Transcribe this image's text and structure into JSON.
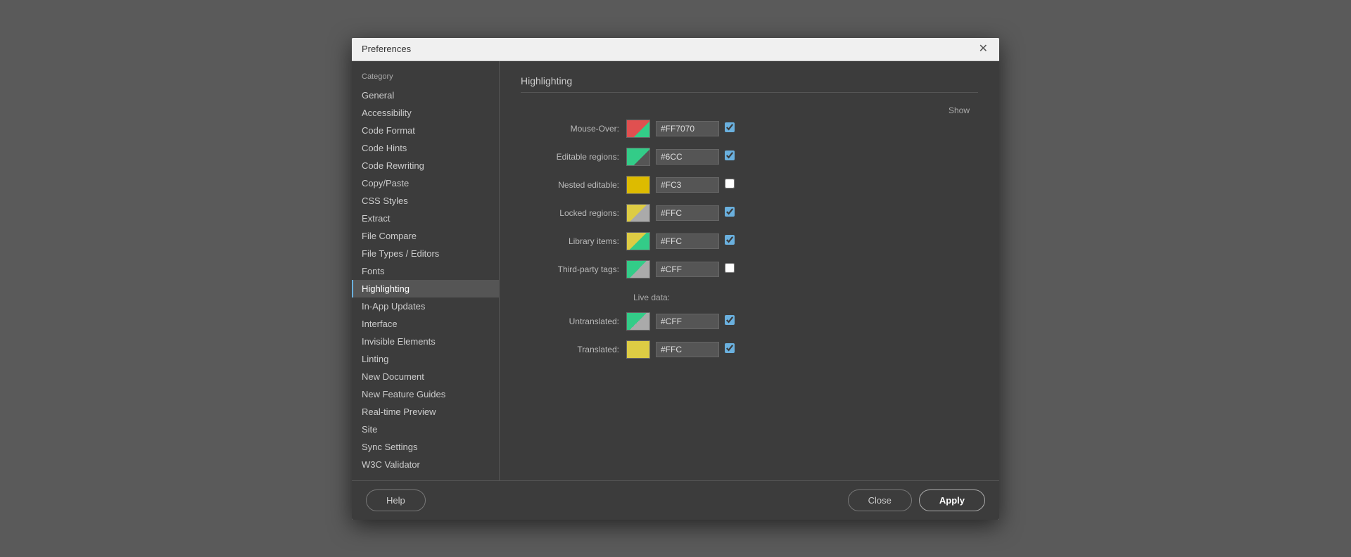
{
  "dialog": {
    "title": "Preferences",
    "close_label": "✕"
  },
  "sidebar": {
    "header": "Category",
    "items": [
      {
        "label": "General",
        "active": false
      },
      {
        "label": "Accessibility",
        "active": false
      },
      {
        "label": "Code Format",
        "active": false
      },
      {
        "label": "Code Hints",
        "active": false
      },
      {
        "label": "Code Rewriting",
        "active": false
      },
      {
        "label": "Copy/Paste",
        "active": false
      },
      {
        "label": "CSS Styles",
        "active": false
      },
      {
        "label": "Extract",
        "active": false
      },
      {
        "label": "File Compare",
        "active": false
      },
      {
        "label": "File Types / Editors",
        "active": false
      },
      {
        "label": "Fonts",
        "active": false
      },
      {
        "label": "Highlighting",
        "active": true
      },
      {
        "label": "In-App Updates",
        "active": false
      },
      {
        "label": "Interface",
        "active": false
      },
      {
        "label": "Invisible Elements",
        "active": false
      },
      {
        "label": "Linting",
        "active": false
      },
      {
        "label": "New Document",
        "active": false
      },
      {
        "label": "New Feature Guides",
        "active": false
      },
      {
        "label": "Real-time Preview",
        "active": false
      },
      {
        "label": "Site",
        "active": false
      },
      {
        "label": "Sync Settings",
        "active": false
      },
      {
        "label": "W3C Validator",
        "active": false
      }
    ]
  },
  "content": {
    "title": "Highlighting",
    "show_label": "Show",
    "rows": [
      {
        "label": "Mouse-Over:",
        "color": "#FF7070",
        "checked": true,
        "swatch_class": "swatch-mouseover"
      },
      {
        "label": "Editable regions:",
        "color": "#6CC",
        "checked": true,
        "swatch_class": "swatch-editable"
      },
      {
        "label": "Nested editable:",
        "color": "#FC3",
        "checked": false,
        "swatch_class": "swatch-nested"
      },
      {
        "label": "Locked regions:",
        "color": "#FFC",
        "checked": true,
        "swatch_class": "swatch-locked"
      },
      {
        "label": "Library items:",
        "color": "#FFC",
        "checked": true,
        "swatch_class": "swatch-library"
      },
      {
        "label": "Third-party tags:",
        "color": "#CFF",
        "checked": false,
        "swatch_class": "swatch-thirdparty"
      }
    ],
    "live_data_label": "Live data:",
    "live_rows": [
      {
        "label": "Untranslated:",
        "color": "#CFF",
        "checked": true,
        "swatch_class": "swatch-untranslated"
      },
      {
        "label": "Translated:",
        "color": "#FFC",
        "checked": true,
        "swatch_class": "swatch-translated"
      }
    ]
  },
  "footer": {
    "help_label": "Help",
    "close_label": "Close",
    "apply_label": "Apply"
  }
}
